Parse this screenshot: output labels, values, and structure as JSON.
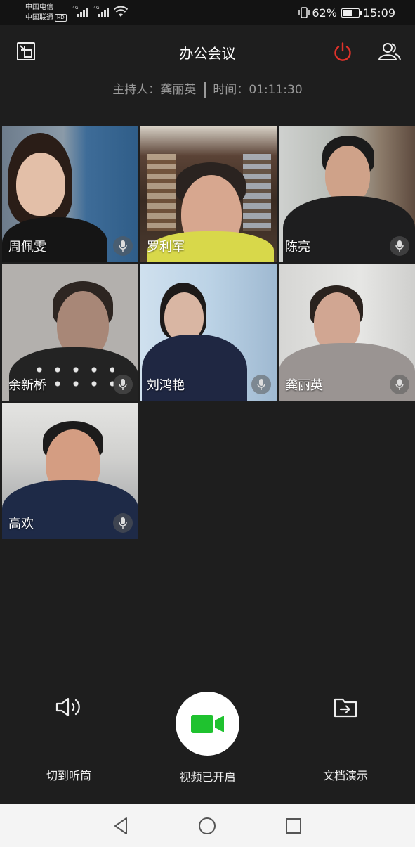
{
  "status_bar": {
    "carrier1": "中国电信",
    "carrier2": "中国联通",
    "hd": "HD",
    "net1": "4G",
    "net2": "4G",
    "battery_text": "62%",
    "battery_level": 0.62,
    "time": "15:09"
  },
  "header": {
    "title": "办公会议",
    "host_label": "主持人：",
    "host_name": "龚丽英",
    "time_label": "时间：",
    "time_value": "01:11:30",
    "accent_color": "#e0322a"
  },
  "participants": [
    {
      "name": "周佩雯"
    },
    {
      "name": "罗利军"
    },
    {
      "name": "陈亮"
    },
    {
      "name": "余新桥"
    },
    {
      "name": "刘鸿艳"
    },
    {
      "name": "龚丽英"
    },
    {
      "name": "高欢"
    }
  ],
  "controls": {
    "speaker_label": "切到听筒",
    "video_label": "视频已开启",
    "doc_label": "文档演示",
    "video_icon_color": "#1fc22f"
  },
  "icons": {
    "minimize": "minimize-window-icon",
    "power": "power-icon",
    "participants": "participants-icon",
    "mic": "mic-icon",
    "speaker": "speaker-icon",
    "video": "video-camera-icon",
    "doc": "share-document-icon",
    "back": "back-triangle-icon",
    "home": "home-circle-icon",
    "recents": "recents-square-icon"
  }
}
